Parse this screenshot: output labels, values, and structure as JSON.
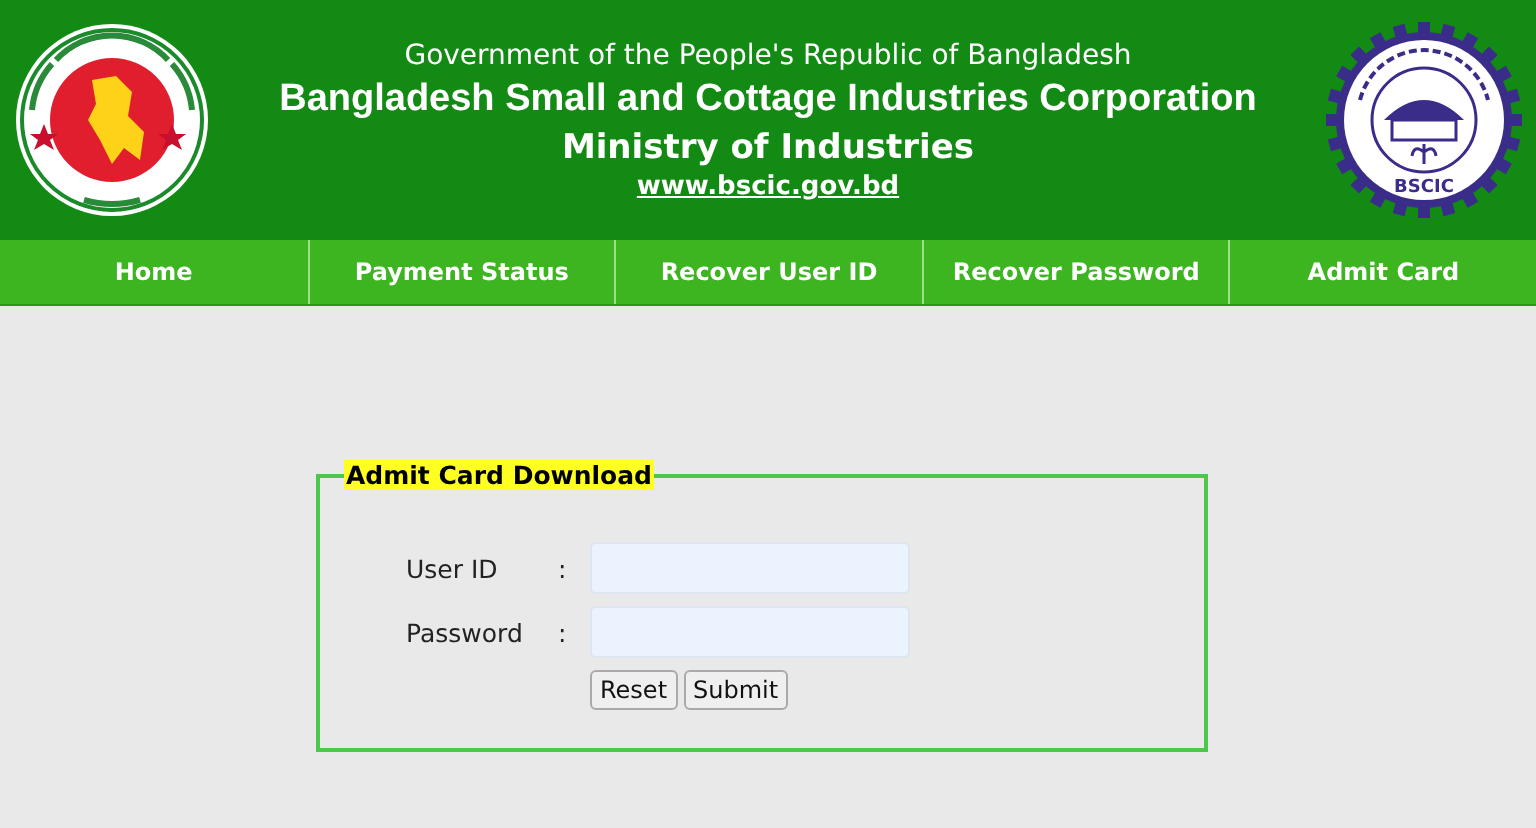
{
  "header": {
    "line_1": "Government of the People's Republic of Bangladesh",
    "title": "Bangladesh Small and Cottage Industries Corporation",
    "ministry": "Ministry of Industries",
    "website": "www.bscic.gov.bd",
    "right_logo_text": "BSCIC"
  },
  "nav": [
    {
      "label": "Home"
    },
    {
      "label": "Payment Status"
    },
    {
      "label": "Recover User ID"
    },
    {
      "label": "Recover Password"
    },
    {
      "label": "Admit Card"
    }
  ],
  "form": {
    "legend": "Admit Card Download",
    "fields": [
      {
        "label": "User ID",
        "separator": ":"
      },
      {
        "label": "Password",
        "separator": ":"
      }
    ],
    "buttons": [
      {
        "label": "Reset"
      },
      {
        "label": "Submit"
      }
    ]
  }
}
